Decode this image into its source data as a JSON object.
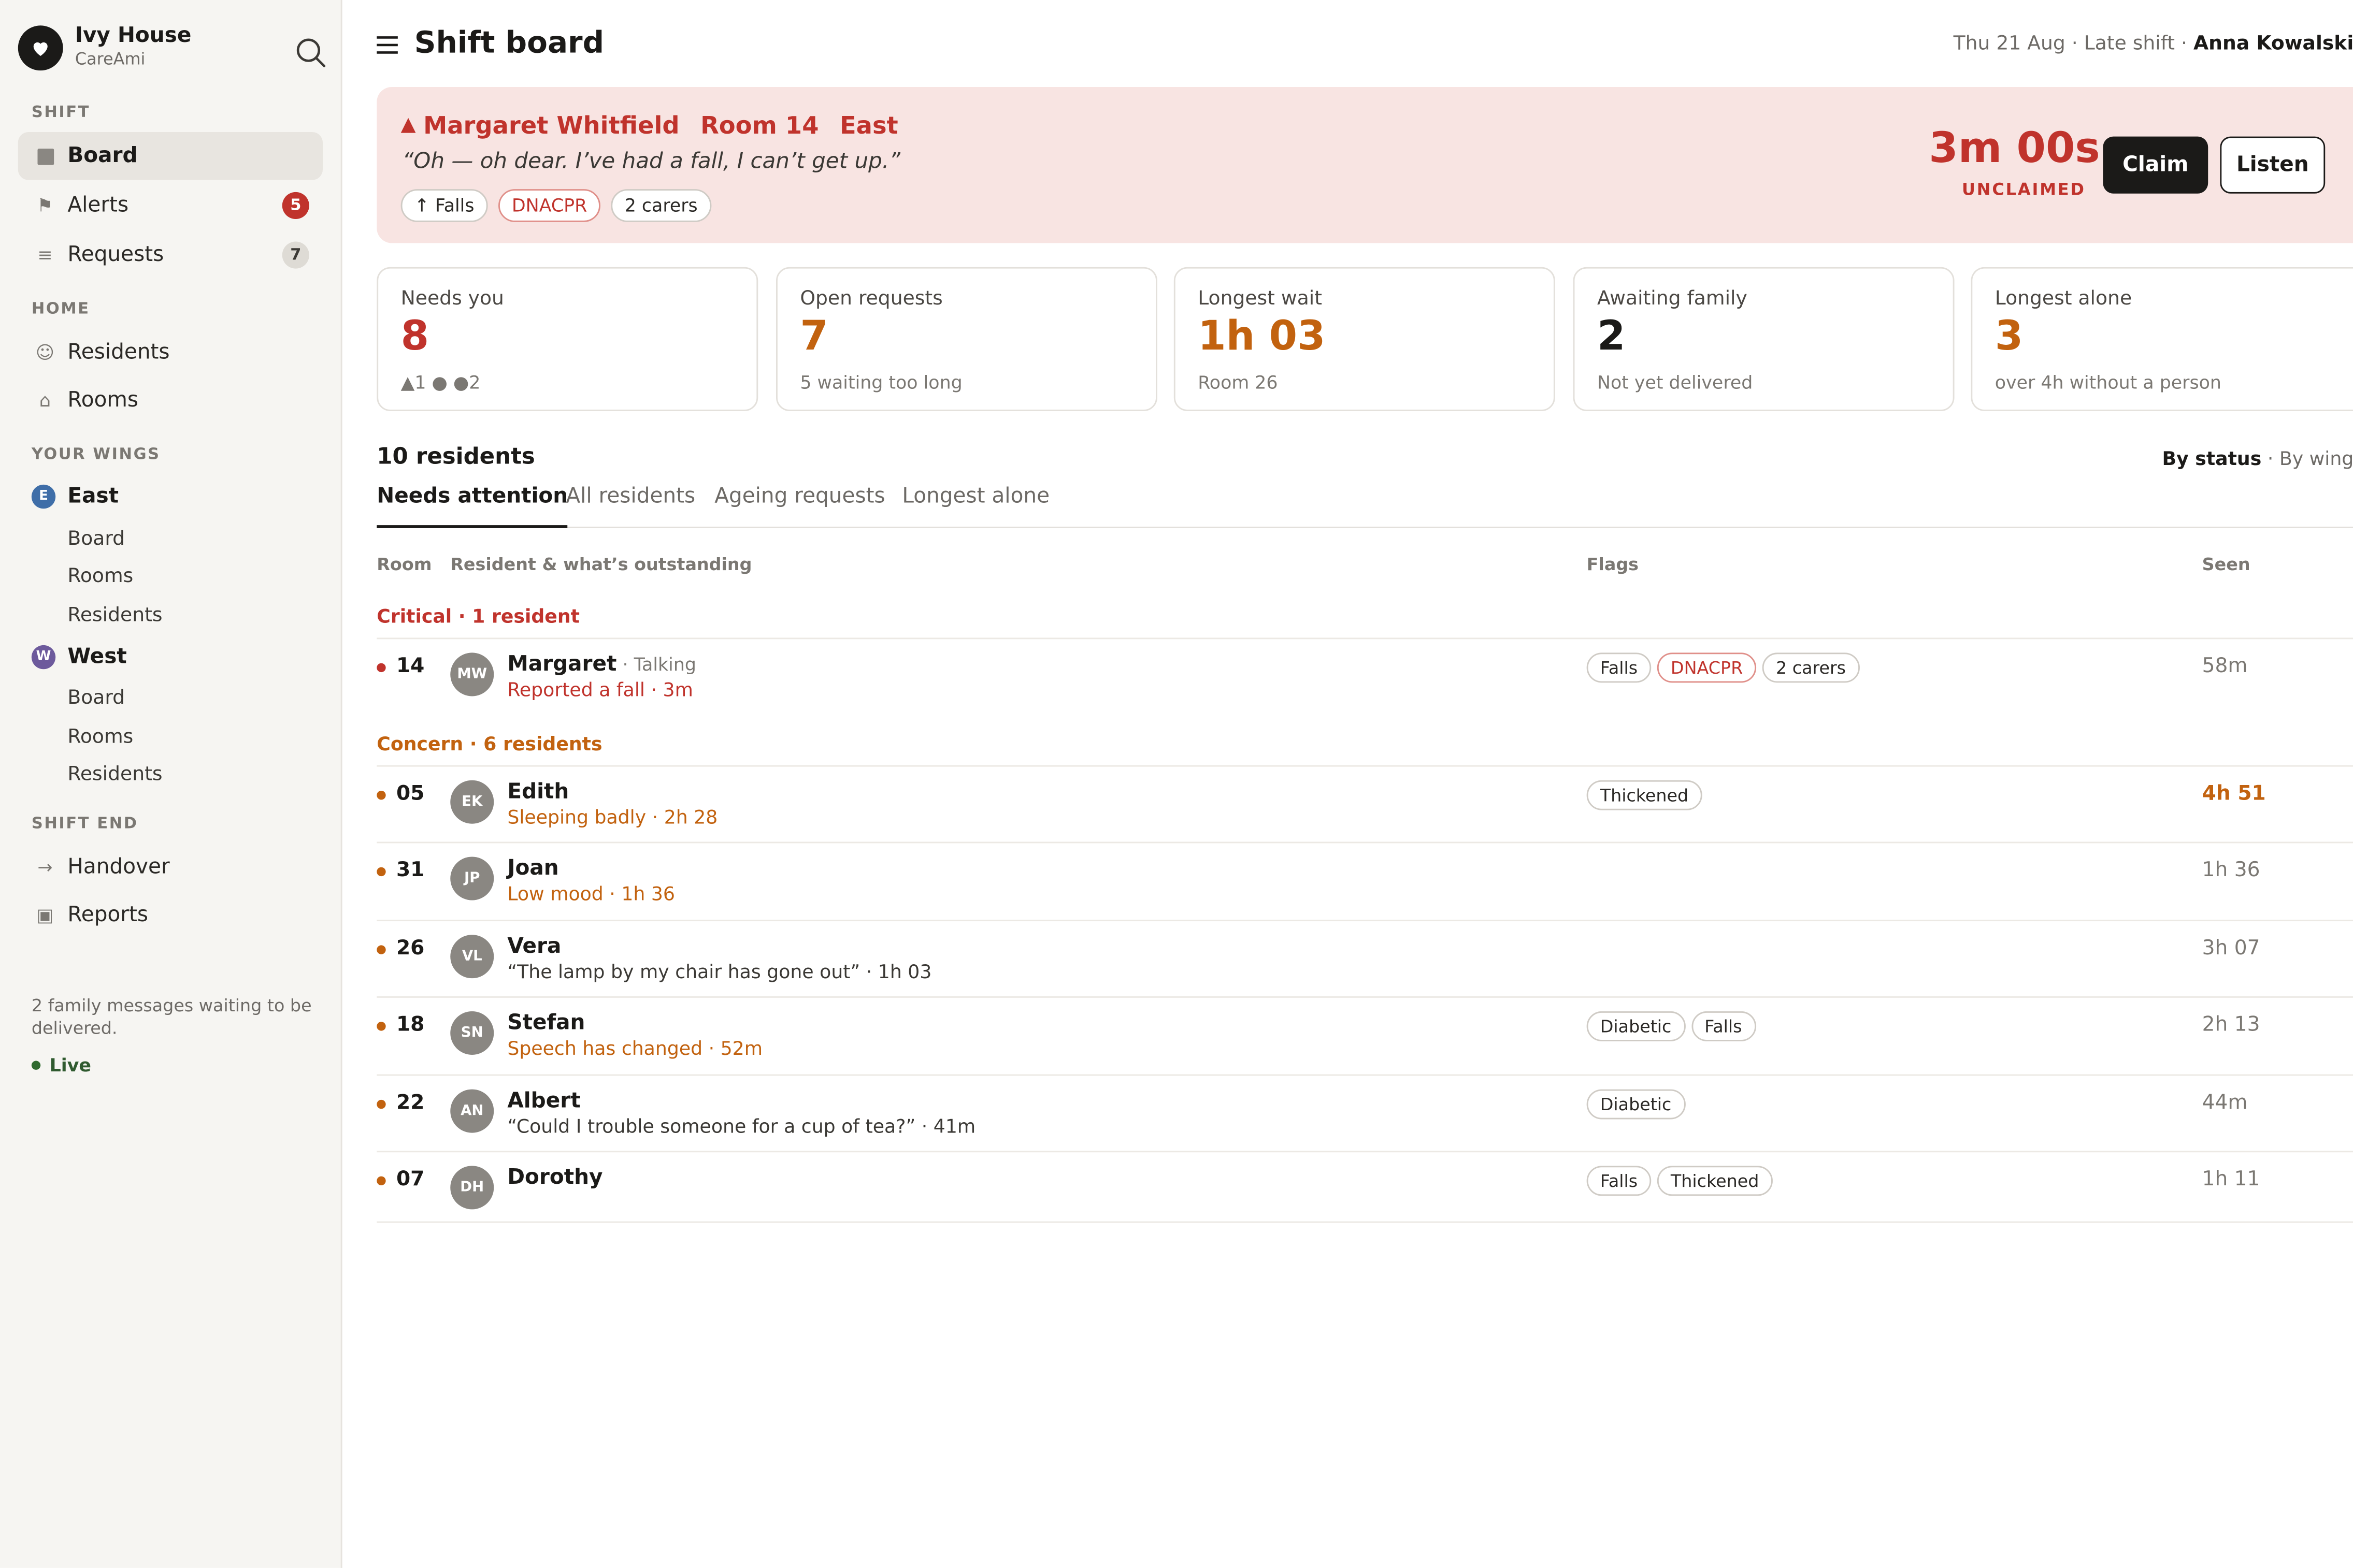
{
  "app": {
    "name": "Ivy House",
    "product": "CareAmi"
  },
  "sidebar": {
    "shift_label": "SHIFT",
    "shift_items": [
      {
        "label": "Board",
        "icon": "board-icon",
        "active": true
      },
      {
        "label": "Alerts",
        "icon": "flag-icon",
        "count": "5"
      },
      {
        "label": "Requests",
        "icon": "list-icon",
        "count": "7"
      }
    ],
    "home_label": "HOME",
    "home_items": [
      {
        "label": "Residents",
        "icon": "face-icon"
      },
      {
        "label": "Rooms",
        "icon": "house-icon"
      }
    ],
    "wings_label": "YOUR WINGS",
    "wings": [
      {
        "initial": "E",
        "name": "East",
        "color": "#3f6ea8",
        "items": [
          "Board",
          "Rooms",
          "Residents"
        ]
      },
      {
        "initial": "W",
        "name": "West",
        "color": "#6d5a9c",
        "items": [
          "Board",
          "Rooms",
          "Residents"
        ]
      }
    ],
    "end_label": "SHIFT END",
    "end_items": [
      {
        "label": "Handover",
        "icon": "arrow-right-icon"
      },
      {
        "label": "Reports",
        "icon": "report-icon"
      }
    ],
    "family_note": "2 family messages waiting to be delivered.",
    "live_label": "Live"
  },
  "header": {
    "title": "Shift board",
    "meta": "Thu 21 Aug · Late shift ·",
    "user": "Anna Kowalski"
  },
  "alert": {
    "name": "Margaret Whitfield",
    "room": "Room 14",
    "wing": "East",
    "quote": "“Oh — oh dear. I’ve had a fall, I can’t get up.”",
    "chips": [
      "↑ Falls",
      "DNACPR",
      "2 carers"
    ],
    "timer": "3m 00s",
    "status": "UNCLAIMED",
    "claim_label": "Claim",
    "listen_label": "Listen"
  },
  "stats": [
    {
      "label": "Needs you",
      "value": "8",
      "note": "▲1  ● ●2",
      "tone": "red"
    },
    {
      "label": "Open requests",
      "value": "7",
      "note": "5 waiting too long",
      "tone": "orange"
    },
    {
      "label": "Longest wait",
      "value": "1h 03",
      "note": "Room 26",
      "tone": "orange"
    },
    {
      "label": "Awaiting family",
      "value": "2",
      "note": "Not yet delivered",
      "tone": "dark"
    },
    {
      "label": "Longest alone",
      "value": "3",
      "note": "over 4h without a person",
      "tone": "orange"
    }
  ],
  "residents": {
    "title": "10 residents",
    "sort_active": "By status",
    "sort_other": " · By wing",
    "tabs": [
      "Needs attention",
      "All residents",
      "Ageing requests",
      "Longest alone"
    ],
    "columns": [
      "Room",
      "Resident & what’s outstanding",
      "Flags",
      "Seen"
    ],
    "groups": {
      "critical": "Critical · 1 resident",
      "concern": "Concern · 6 residents"
    },
    "rows": [
      {
        "room": "14",
        "initials": "MW",
        "name": "Margaret",
        "state": " · Talking",
        "desc": "Reported a fall · 3m",
        "flags": [
          "Falls",
          "DNACPR",
          "2 carers"
        ],
        "seen": "58m"
      },
      {
        "room": "05",
        "initials": "EK",
        "name": "Edith",
        "desc": "Sleeping badly · 2h 28",
        "flags": [
          "Thickened"
        ],
        "seen": "4h 51"
      },
      {
        "room": "31",
        "initials": "JP",
        "name": "Joan",
        "desc": "Low mood · 1h 36",
        "flags": [],
        "seen": "1h 36"
      },
      {
        "room": "26",
        "initials": "VL",
        "name": "Vera",
        "desc": "“The lamp by my chair has gone out” · 1h 03",
        "flags": [],
        "seen": "3h 07"
      },
      {
        "room": "18",
        "initials": "SN",
        "name": "Stefan",
        "desc": "Speech has changed · 52m",
        "flags": [
          "Diabetic",
          "Falls"
        ],
        "seen": "2h 13"
      },
      {
        "room": "22",
        "initials": "AN",
        "name": "Albert",
        "desc": "“Could I trouble someone for a cup of tea?” · 41m",
        "flags": [
          "Diabetic"
        ],
        "seen": "44m"
      },
      {
        "room": "07",
        "initials": "DH",
        "name": "Dorothy",
        "desc": "",
        "flags": [
          "Falls",
          "Thickened"
        ],
        "seen": "1h 11"
      }
    ]
  },
  "colors": {
    "critical": "#c0332c",
    "concern": "#c2620f",
    "banner_bg": "#f8e4e2"
  }
}
